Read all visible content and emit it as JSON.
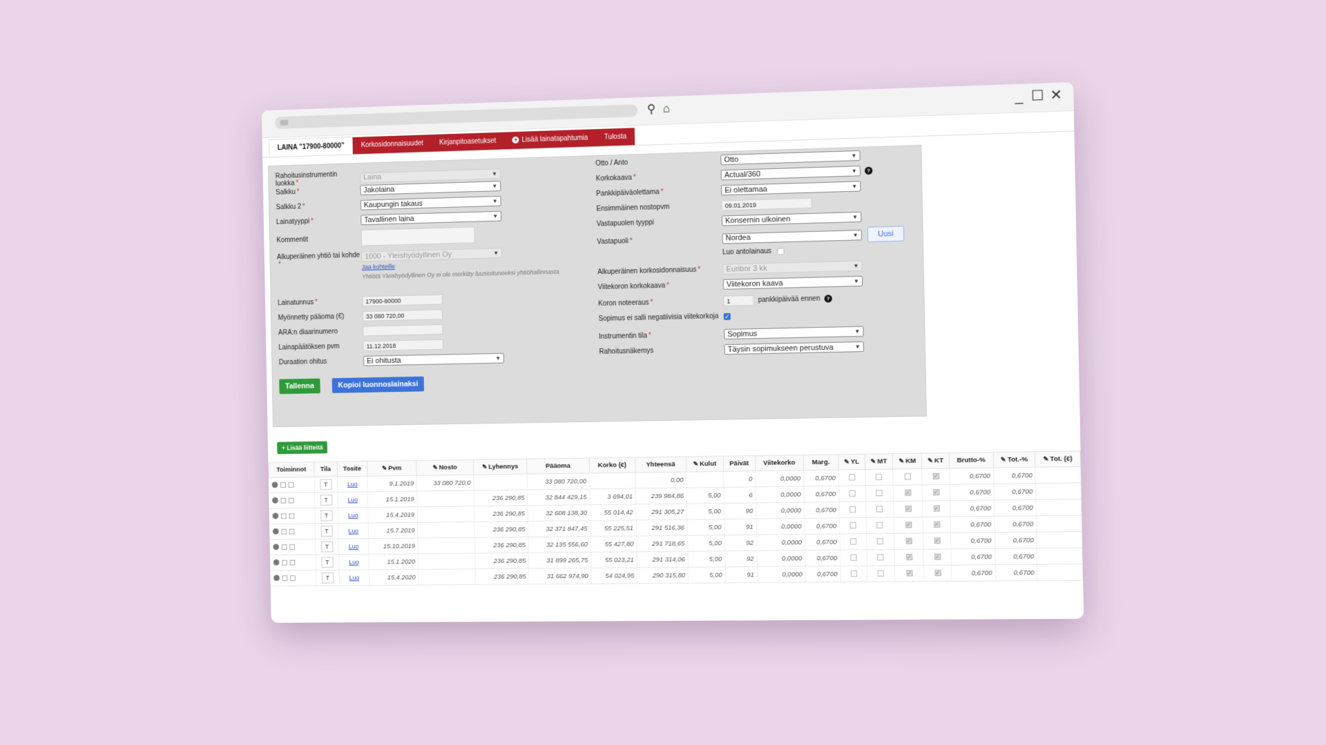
{
  "window": {
    "controls": {
      "minimize": "_",
      "maximize": "☐",
      "close": "✕"
    }
  },
  "tabs": [
    {
      "label": "LAINA \"17900-80000\"",
      "active": true
    },
    {
      "label": "Korkosidonnaisuudet"
    },
    {
      "label": "Kirjanpitoasetukset"
    },
    {
      "label": "Lisää lainatapahtumia",
      "icon": "plus-icon"
    },
    {
      "label": "Tulosta"
    }
  ],
  "left": {
    "rahoitusluokka": {
      "label": "Rahoitusinstrumentin luokka",
      "value": "Laina"
    },
    "salkku": {
      "label": "Salkku",
      "value": "Jakolaina"
    },
    "salkku2": {
      "label": "Salkku 2",
      "value": "Kaupungin takaus"
    },
    "lainatyyppi": {
      "label": "Lainatyyppi",
      "value": "Tavallinen laina"
    },
    "kommentit": {
      "label": "Kommentit"
    },
    "alkuperainen": {
      "label": "Alkuperäinen yhtiö tai kohde",
      "value": "1000 - Yleishyödyllinen Oy",
      "link": "Jaa kohteille",
      "hint": "Yhtiötä Yleishyödyllinen Oy ei ole merkitty fuusioituneeksi yhtiöhallinnasta"
    },
    "lainatunnus": {
      "label": "Lainatunnus",
      "value": "17900-80000"
    },
    "paaoma": {
      "label": "Myönnetty pääoma (€)",
      "value": "33 080 720,00"
    },
    "ara": {
      "label": "ARA:n diaarinumero",
      "value": ""
    },
    "paatos": {
      "label": "Lainapäätöksen pvm",
      "value": "11.12.2018"
    },
    "duraatio": {
      "label": "Duraation ohitus",
      "value": "Ei ohitusta"
    }
  },
  "right": {
    "otto": {
      "label": "Otto / Anto",
      "value": "Otto"
    },
    "korkokaava": {
      "label": "Korkokaava",
      "value": "Actual/360"
    },
    "pankkipaiva": {
      "label": "Pankkipäiväolettama",
      "value": "Ei olettamaa"
    },
    "nostopvm": {
      "label": "Ensimmäinen nostopvm",
      "value": "09.01.2019"
    },
    "vastapuolityyppi": {
      "label": "Vastapuolen tyyppi",
      "value": "Konsernin ulkoinen"
    },
    "vastapuoli": {
      "label": "Vastapuoli",
      "value": "Nordea",
      "new_button": "Uusi",
      "antolainaus": "Luo antolainaus"
    },
    "alkkorko": {
      "label": "Alkuperäinen korkosidonnaisuus",
      "value": "Euribor 3 kk"
    },
    "viitekaava": {
      "label": "Viitekoron korkokaava",
      "value": "Viitekoron kaava"
    },
    "noteeraus": {
      "label": "Koron noteeraus",
      "value": "1",
      "suffix": "pankkipäivää ennen"
    },
    "negatiivinen": {
      "label": "Sopimus ei salli negatiivisia viitekorkoja",
      "checked": true
    },
    "tila": {
      "label": "Instrumentin tila",
      "value": "Sopimus"
    },
    "rahoitusnakemys": {
      "label": "Rahoitusnäkemys",
      "value": "Täysin sopimukseen perustuva"
    }
  },
  "buttons": {
    "save": "Tallenna",
    "copy": "Kopioi luonnoslainaksi",
    "add_attachments": "+ Lisää liitteitä"
  },
  "table": {
    "headers": [
      "Toiminnot",
      "Tila",
      "Tosite",
      "Pvm",
      "Nosto",
      "Lyhennys",
      "Pääoma",
      "Korko (€)",
      "Yhteensä",
      "Kulut",
      "Päivät",
      "Viitekorko",
      "Marg.",
      "YL",
      "MT",
      "KM",
      "KT",
      "Brutto-%",
      "Tot.-%",
      "Tot. (€)"
    ],
    "rows": [
      {
        "tila": "T",
        "tosite": "Luo",
        "pvm": "9.1.2019",
        "nosto": "33 080 720,0",
        "lyhennys": "",
        "paaoma": "33 080 720,00",
        "korko": "",
        "yhteensa": "0,00",
        "kulut": "",
        "paivat": "0",
        "viitekorko": "0,0000",
        "marg": "0,6700",
        "yl": false,
        "mt": false,
        "km": false,
        "kt": true,
        "brutto": "0,6700",
        "tot": "0,6700",
        "tote": ""
      },
      {
        "tila": "T",
        "tosite": "Luo",
        "pvm": "15.1.2019",
        "nosto": "",
        "lyhennys": "236 290,85",
        "paaoma": "32 844 429,15",
        "korko": "3 694,01",
        "yhteensa": "239 984,86",
        "kulut": "5,00",
        "paivat": "6",
        "viitekorko": "0,0000",
        "marg": "0,6700",
        "yl": false,
        "mt": false,
        "km": true,
        "kt": true,
        "brutto": "0,6700",
        "tot": "0,6700",
        "tote": ""
      },
      {
        "tila": "T",
        "tosite": "Luo",
        "pvm": "15.4.2019",
        "nosto": "",
        "lyhennys": "236 290,85",
        "paaoma": "32 608 138,30",
        "korko": "55 014,42",
        "yhteensa": "291 305,27",
        "kulut": "5,00",
        "paivat": "90",
        "viitekorko": "0,0000",
        "marg": "0,6700",
        "yl": false,
        "mt": false,
        "km": true,
        "kt": true,
        "brutto": "0,6700",
        "tot": "0,6700",
        "tote": ""
      },
      {
        "tila": "T",
        "tosite": "Luo",
        "pvm": "15.7.2019",
        "nosto": "",
        "lyhennys": "236 290,85",
        "paaoma": "32 371 847,45",
        "korko": "55 225,51",
        "yhteensa": "291 516,36",
        "kulut": "5,00",
        "paivat": "91",
        "viitekorko": "0,0000",
        "marg": "0,6700",
        "yl": false,
        "mt": false,
        "km": true,
        "kt": true,
        "brutto": "0,6700",
        "tot": "0,6700",
        "tote": ""
      },
      {
        "tila": "T",
        "tosite": "Luo",
        "pvm": "15.10.2019",
        "nosto": "",
        "lyhennys": "236 290,85",
        "paaoma": "32 135 556,60",
        "korko": "55 427,80",
        "yhteensa": "291 718,65",
        "kulut": "5,00",
        "paivat": "92",
        "viitekorko": "0,0000",
        "marg": "0,6700",
        "yl": false,
        "mt": false,
        "km": true,
        "kt": true,
        "brutto": "0,6700",
        "tot": "0,6700",
        "tote": ""
      },
      {
        "tila": "T",
        "tosite": "Luo",
        "pvm": "15.1.2020",
        "nosto": "",
        "lyhennys": "236 290,85",
        "paaoma": "31 899 265,75",
        "korko": "55 023,21",
        "yhteensa": "291 314,06",
        "kulut": "5,00",
        "paivat": "92",
        "viitekorko": "0,0000",
        "marg": "0,6700",
        "yl": false,
        "mt": false,
        "km": true,
        "kt": true,
        "brutto": "0,6700",
        "tot": "0,6700",
        "tote": ""
      },
      {
        "tila": "T",
        "tosite": "Luo",
        "pvm": "15.4.2020",
        "nosto": "",
        "lyhennys": "236 290,85",
        "paaoma": "31 662 974,90",
        "korko": "54 024,95",
        "yhteensa": "290 315,80",
        "kulut": "5,00",
        "paivat": "91",
        "viitekorko": "0,0000",
        "marg": "0,6700",
        "yl": false,
        "mt": false,
        "km": true,
        "kt": true,
        "brutto": "0,6700",
        "tot": "0,6700",
        "tote": ""
      }
    ]
  }
}
